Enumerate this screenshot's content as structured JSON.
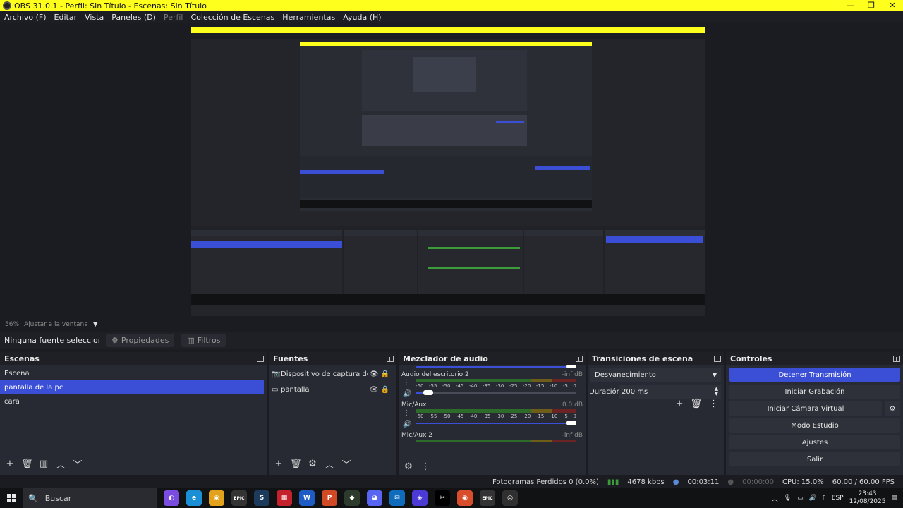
{
  "window": {
    "title": "OBS 31.0.1 - Perfil: Sin Título - Escenas: Sin Título",
    "minimize": "—",
    "restore": "❐",
    "close": "✕"
  },
  "menu": [
    "Archivo (F)",
    "Editar",
    "Vista",
    "Paneles (D)",
    "Perfil",
    "Colección de Escenas",
    "Herramientas",
    "Ayuda (H)"
  ],
  "zoom": {
    "percent": "56%",
    "fit_label": "Ajustar a la ventana"
  },
  "props": {
    "no_source": "Ninguna fuente seleccionada",
    "properties": "Propiedades",
    "filters": "Filtros"
  },
  "scenes": {
    "title": "Escenas",
    "items": [
      "Escena",
      "pantalla de la pc",
      "cara"
    ],
    "selected_index": 1
  },
  "sources": {
    "title": "Fuentes",
    "items": [
      "Dispositivo de captura de video",
      "pantalla"
    ]
  },
  "mixer": {
    "title": "Mezclador de audio",
    "channels": [
      {
        "name": "Audio del escritorio 2",
        "db": "-inf dB",
        "level": 0.05
      },
      {
        "name": "Mic/Aux",
        "db": "0.0 dB",
        "level": 1.0
      },
      {
        "name": "Mic/Aux 2",
        "db": "-inf dB",
        "level": 0.0
      }
    ],
    "ticks": [
      "-60",
      "-55",
      "-50",
      "-45",
      "-40",
      "-35",
      "-30",
      "-25",
      "-20",
      "-15",
      "-10",
      "-5",
      "0"
    ]
  },
  "transitions": {
    "title": "Transiciones de escena",
    "selected": "Desvanecimiento",
    "duration_label": "Duración",
    "duration_value": "200 ms"
  },
  "controls": {
    "title": "Controles",
    "buttons": [
      "Detener Transmisión",
      "Iniciar Grabación",
      "Iniciar Cámara Virtual",
      "Modo Estudio",
      "Ajustes",
      "Salir"
    ]
  },
  "status": {
    "dropped": "Fotogramas Perdidos 0 (0.0%)",
    "bitrate": "4678 kbps",
    "stream_time": "00:03:11",
    "rec_time": "00:00:00",
    "cpu": "CPU: 15.0%",
    "fps": "60.00 / 60.00 FPS"
  },
  "taskbar": {
    "search": "Buscar",
    "lang": "ESP",
    "time": "23:43",
    "date": "12/08/2025",
    "apps": [
      {
        "name": "copilot-icon",
        "color": "#7a4de0",
        "glyph": "◐"
      },
      {
        "name": "edge-icon",
        "color": "#1b8fd6",
        "glyph": "e"
      },
      {
        "name": "chrome-icon",
        "color": "#e2a21b",
        "glyph": "◉"
      },
      {
        "name": "epic-games-icon",
        "color": "#333333",
        "glyph": "EPIC"
      },
      {
        "name": "steam-icon",
        "color": "#1b3a5c",
        "glyph": "S"
      },
      {
        "name": "app-icon",
        "color": "#c5212c",
        "glyph": "▦"
      },
      {
        "name": "word-icon",
        "color": "#1f5bc4",
        "glyph": "W"
      },
      {
        "name": "powerpoint-icon",
        "color": "#d14a25",
        "glyph": "P"
      },
      {
        "name": "app2-icon",
        "color": "#2c3b2c",
        "glyph": "◆"
      },
      {
        "name": "discord-icon",
        "color": "#5865f2",
        "glyph": "◕"
      },
      {
        "name": "mail-icon",
        "color": "#0f6cbd",
        "glyph": "✉"
      },
      {
        "name": "app3-icon",
        "color": "#4b3ad6",
        "glyph": "◈"
      },
      {
        "name": "capcut-icon",
        "color": "#000000",
        "glyph": "✂"
      },
      {
        "name": "chrome2-icon",
        "color": "#d84e2c",
        "glyph": "◉"
      },
      {
        "name": "epic2-icon",
        "color": "#333333",
        "glyph": "EPIC"
      },
      {
        "name": "obs-icon",
        "color": "#303030",
        "glyph": "◎"
      }
    ]
  }
}
